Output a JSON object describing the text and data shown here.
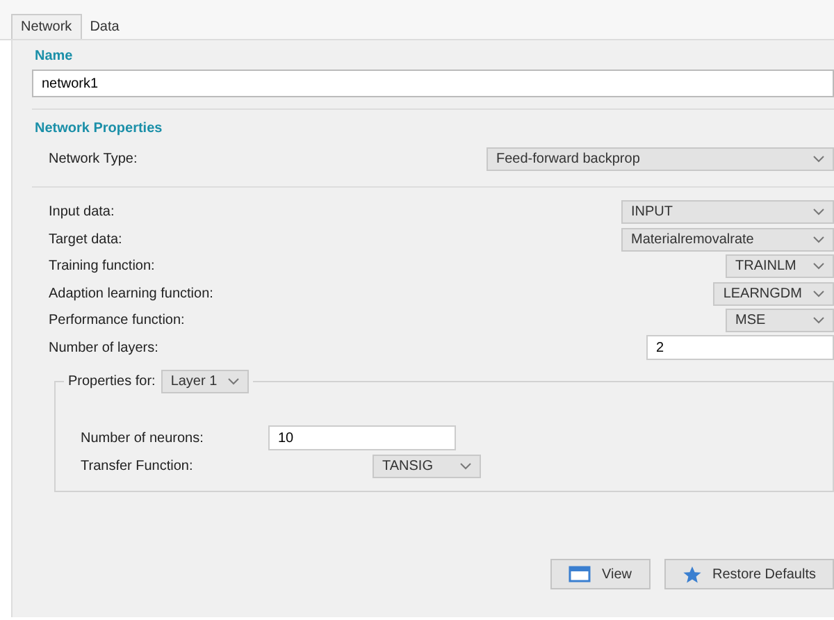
{
  "tabs": [
    {
      "label": "Network",
      "selected": true
    },
    {
      "label": "Data",
      "selected": false
    }
  ],
  "name_section": {
    "title": "Name",
    "value": "network1"
  },
  "properties": {
    "title": "Network Properties",
    "network_type": {
      "label": "Network Type:",
      "value": "Feed-forward backprop"
    },
    "rows": [
      {
        "kind": "dropdown",
        "label": "Input data:",
        "value": "INPUT"
      },
      {
        "kind": "dropdown",
        "label": "Target data:",
        "value": "Materialremovalrate"
      },
      {
        "kind": "dropdown",
        "label": "Training function:",
        "value": "TRAINLM"
      },
      {
        "kind": "dropdown",
        "label": "Adaption learning function:",
        "value": "LEARNGDM"
      },
      {
        "kind": "dropdown",
        "label": "Performance function:",
        "value": "MSE"
      },
      {
        "kind": "input",
        "label": "Number of layers:",
        "value": "2"
      }
    ]
  },
  "layer_group": {
    "label": "Properties for:",
    "layer": "Layer 1",
    "neurons": {
      "label": "Number of neurons:",
      "value": "10"
    },
    "transfer": {
      "label": "Transfer Function:",
      "value": "TANSIG"
    }
  },
  "buttons": [
    {
      "kind": "view",
      "label": "View"
    },
    {
      "kind": "restore",
      "label": "Restore Defaults"
    }
  ]
}
